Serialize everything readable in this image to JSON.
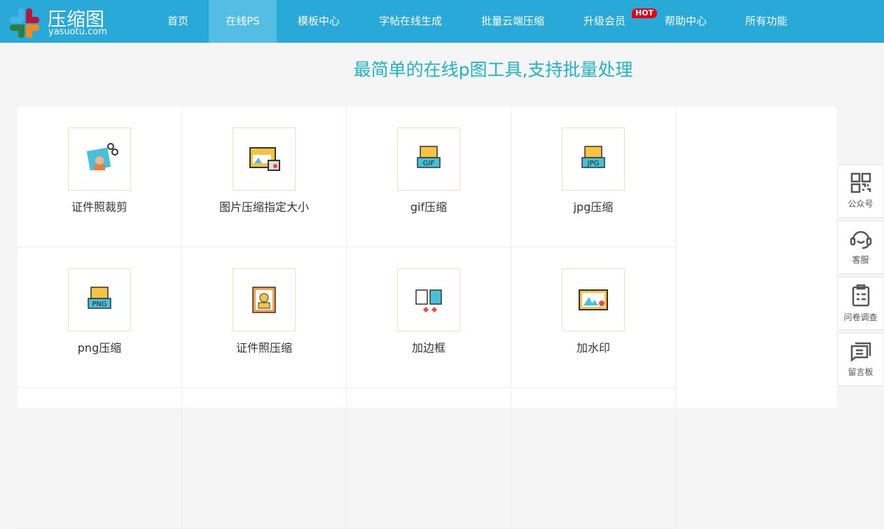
{
  "logo": {
    "name": "压缩图",
    "url": "yasuotu.com"
  },
  "nav": [
    {
      "label": "首页"
    },
    {
      "label": "在线PS",
      "active": true
    },
    {
      "label": "模板中心"
    },
    {
      "label": "字帖在线生成"
    },
    {
      "label": "批量云端压缩"
    },
    {
      "label": "升级会员",
      "badge": "HOT"
    },
    {
      "label": "帮助中心"
    },
    {
      "label": "所有功能"
    }
  ],
  "title": "最简单的在线p图工具,支持批量处理",
  "tools": [
    {
      "label": "证件照裁剪",
      "icon": "id-photo-crop-icon"
    },
    {
      "label": "图片压缩指定大小",
      "icon": "image-compress-size-icon"
    },
    {
      "label": "gif压缩",
      "icon": "gif-icon"
    },
    {
      "label": "jpg压缩",
      "icon": "jpg-icon"
    },
    {
      "label": "png压缩",
      "icon": "png-icon"
    },
    {
      "label": "证件照压缩",
      "icon": "id-photo-icon"
    },
    {
      "label": "加边框",
      "icon": "border-icon"
    },
    {
      "label": "加水印",
      "icon": "watermark-icon"
    }
  ],
  "side": [
    {
      "label": "公众号"
    },
    {
      "label": "客服"
    },
    {
      "label": "问卷调查"
    },
    {
      "label": "留言板"
    }
  ],
  "colors": {
    "header": "#28a9d8",
    "title": "#20b3c9",
    "hot": "#e60012"
  }
}
